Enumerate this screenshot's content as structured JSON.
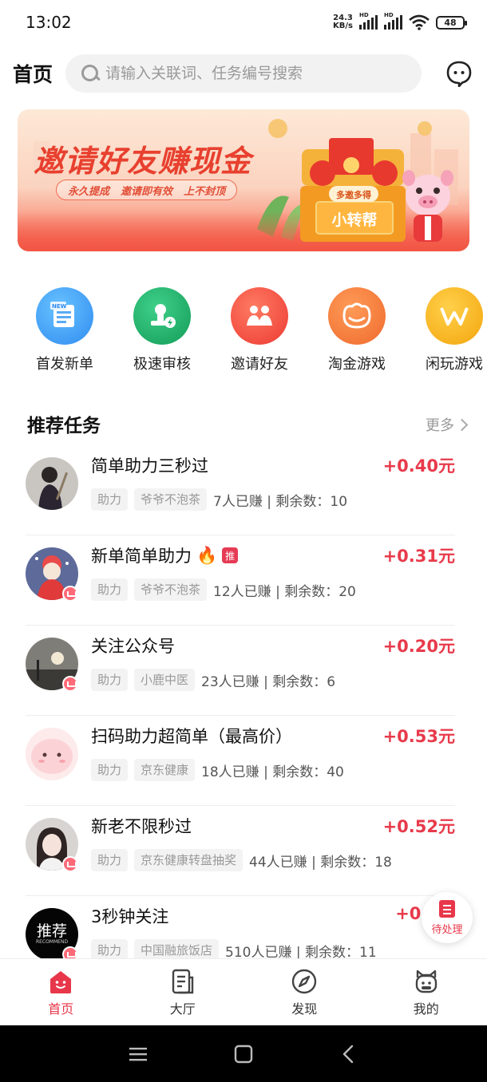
{
  "status": {
    "time": "13:02",
    "net_speed_value": "24.3",
    "net_speed_unit": "KB/s",
    "hd": "HD",
    "battery": "48"
  },
  "header": {
    "title": "首页",
    "search_placeholder": "请输入关联词、任务编号搜索"
  },
  "banner": {
    "headline": "邀请好友赚现金",
    "tags": [
      "永久提成",
      "邀请即有效",
      "上不封顶"
    ],
    "badge": "多邀多得",
    "brand": "小转帮"
  },
  "quick": [
    {
      "label": "首发新单",
      "icon": "new-order-icon",
      "color": "#3d9bf5"
    },
    {
      "label": "极速审核",
      "icon": "fast-review-icon",
      "color": "#1fae68"
    },
    {
      "label": "邀请好友",
      "icon": "invite-friends-icon",
      "color": "#f2503f"
    },
    {
      "label": "淘金游戏",
      "icon": "gold-game-icon",
      "color": "#f4793a"
    },
    {
      "label": "闲玩游戏",
      "icon": "leisure-game-icon",
      "color": "#f8b51e"
    }
  ],
  "section": {
    "title": "推荐任务",
    "more": "更多"
  },
  "tasks": [
    {
      "name": "简单助力三秒过",
      "reward": "+0.40元",
      "chip1": "助力",
      "chip2": "爷爷不泡茶",
      "stats": "7人已赚 | 剩余数：10"
    },
    {
      "name": "新单简单助力",
      "badge": "推",
      "reward": "+0.31元",
      "chip1": "助力",
      "chip2": "爷爷不泡茶",
      "stats": "12人已赚 | 剩余数：20"
    },
    {
      "name": "关注公众号",
      "reward": "+0.20元",
      "chip1": "助力",
      "chip2": "小鹿中医",
      "stats": "23人已赚 | 剩余数：6"
    },
    {
      "name": "扫码助力超简单（最高价）",
      "reward": "+0.53元",
      "chip1": "助力",
      "chip2": "京东健康",
      "stats": "18人已赚 | 剩余数：40"
    },
    {
      "name": "新老不限秒过",
      "reward": "+0.52元",
      "chip1": "助力",
      "chip2": "京东健康转盘抽奖",
      "stats": "44人已赚 | 剩余数：18"
    },
    {
      "name": "3秒钟关注",
      "reward": "+0.3",
      "chip1": "助力",
      "chip2": "中国融旅饭店",
      "stats": "510人已赚 | 剩余数：11",
      "avatar_text": "推荐",
      "avatar_sub": "RECOMMEND"
    }
  ],
  "pending": {
    "label": "待处理"
  },
  "tabs": [
    {
      "label": "首页",
      "icon": "home-icon"
    },
    {
      "label": "大厅",
      "icon": "hall-icon"
    },
    {
      "label": "发现",
      "icon": "compass-icon"
    },
    {
      "label": "我的",
      "icon": "profile-icon"
    }
  ],
  "colors": {
    "accent": "#e8374a",
    "reward": "#e83a4b"
  }
}
